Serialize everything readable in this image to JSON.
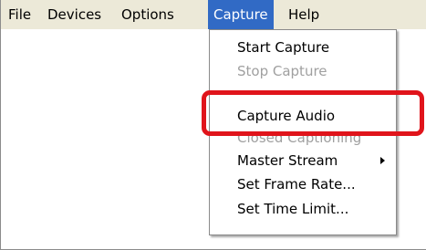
{
  "menubar": {
    "file_label": "File",
    "devices_label": "Devices",
    "options_label": "Options",
    "capture_label": "Capture",
    "help_label": "Help"
  },
  "capture_menu": {
    "start_capture": "Start Capture",
    "stop_capture": "Stop Capture",
    "capture_audio": "Capture Audio",
    "closed_captioning": "Closed Captioning",
    "master_stream": "Master Stream",
    "set_frame_rate": "Set Frame Rate...",
    "set_time_limit": "Set Time Limit..."
  },
  "icons": {
    "submenu_arrow": "chevron-right-icon"
  },
  "colors": {
    "menubar_background": "#ece9d8",
    "active_menu_background": "#316ac5",
    "disabled_text": "#a0a0a0",
    "annotation_highlight": "#e0141b"
  }
}
